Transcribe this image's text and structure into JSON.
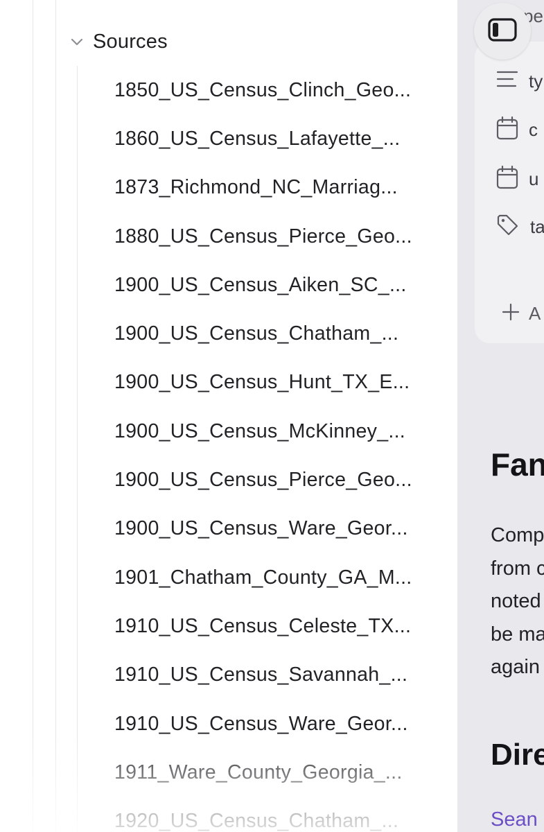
{
  "sidebar": {
    "folder": {
      "label": "Sources",
      "icon": "chevron-down-icon",
      "expanded": true
    },
    "files": [
      "1850_US_Census_Clinch_Geo...",
      "1860_US_Census_Lafayette_...",
      "1873_Richmond_NC_Marriag...",
      "1880_US_Census_Pierce_Geo...",
      "1900_US_Census_Aiken_SC_...",
      "1900_US_Census_Chatham_...",
      "1900_US_Census_Hunt_TX_E...",
      "1900_US_Census_McKinney_...",
      "1900_US_Census_Pierce_Geo...",
      "1900_US_Census_Ware_Geor...",
      "1901_Chatham_County_GA_M...",
      "1910_US_Census_Celeste_TX...",
      "1910_US_Census_Savannah_...",
      "1910_US_Census_Ware_Geor...",
      "1911_Ware_County_Georgia_...",
      "1920_US_Census_Chatham_..."
    ]
  },
  "note": {
    "top_peek": "pe",
    "properties": [
      {
        "icon": "text-lines-icon",
        "label": "ty"
      },
      {
        "icon": "calendar-icon",
        "label": "c"
      },
      {
        "icon": "calendar-icon",
        "label": "u"
      },
      {
        "icon": "tag-icon",
        "label": "ta"
      }
    ],
    "add_property": {
      "icon": "plus-icon",
      "label": "A"
    },
    "heading1": "Fan",
    "body_lines": [
      "Comp",
      "from c",
      "noted",
      "be ma",
      "again"
    ],
    "heading2": "Dire",
    "link": "Sean"
  },
  "colors": {
    "link": "#6c4fc7",
    "right_pane_bg": "#e9e9ed",
    "properties_bg": "#f1f1f4"
  }
}
